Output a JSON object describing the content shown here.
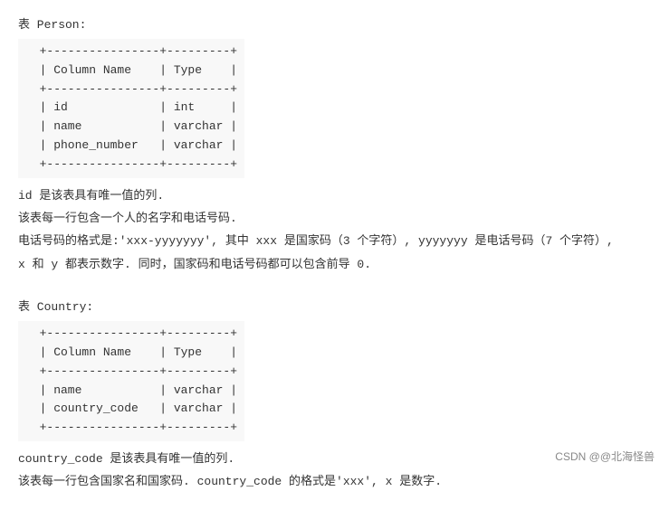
{
  "person_section": {
    "title": "表 Person:",
    "table": "  +----------------+---------+\n  | Column Name    | Type    |\n  +----------------+---------+\n  | id             | int     |\n  | name           | varchar |\n  | phone_number   | varchar |\n  +----------------+---------+",
    "descriptions": [
      "id 是该表具有唯一值的列.",
      "该表每一行包含一个人的名字和电话号码.",
      "电话号码的格式是:'xxx-yyyyyyy', 其中 xxx 是国家码（3 个字符）, yyyyyyy 是电话号码（7 个字符）,",
      "x 和 y 都表示数字. 同时，国家码和电话号码都可以包含前导 0."
    ]
  },
  "country_section": {
    "title": "表 Country:",
    "table": "  +----------------+---------+\n  | Column Name    | Type    |\n  +----------------+---------+\n  | name           | varchar |\n  | country_code   | varchar |\n  +----------------+---------+",
    "descriptions": [
      "country_code 是该表具有唯一值的列.",
      "该表每一行包含国家名和国家码. country_code 的格式是'xxx', x 是数字."
    ]
  },
  "watermark": "CSDN @@北海怪兽"
}
